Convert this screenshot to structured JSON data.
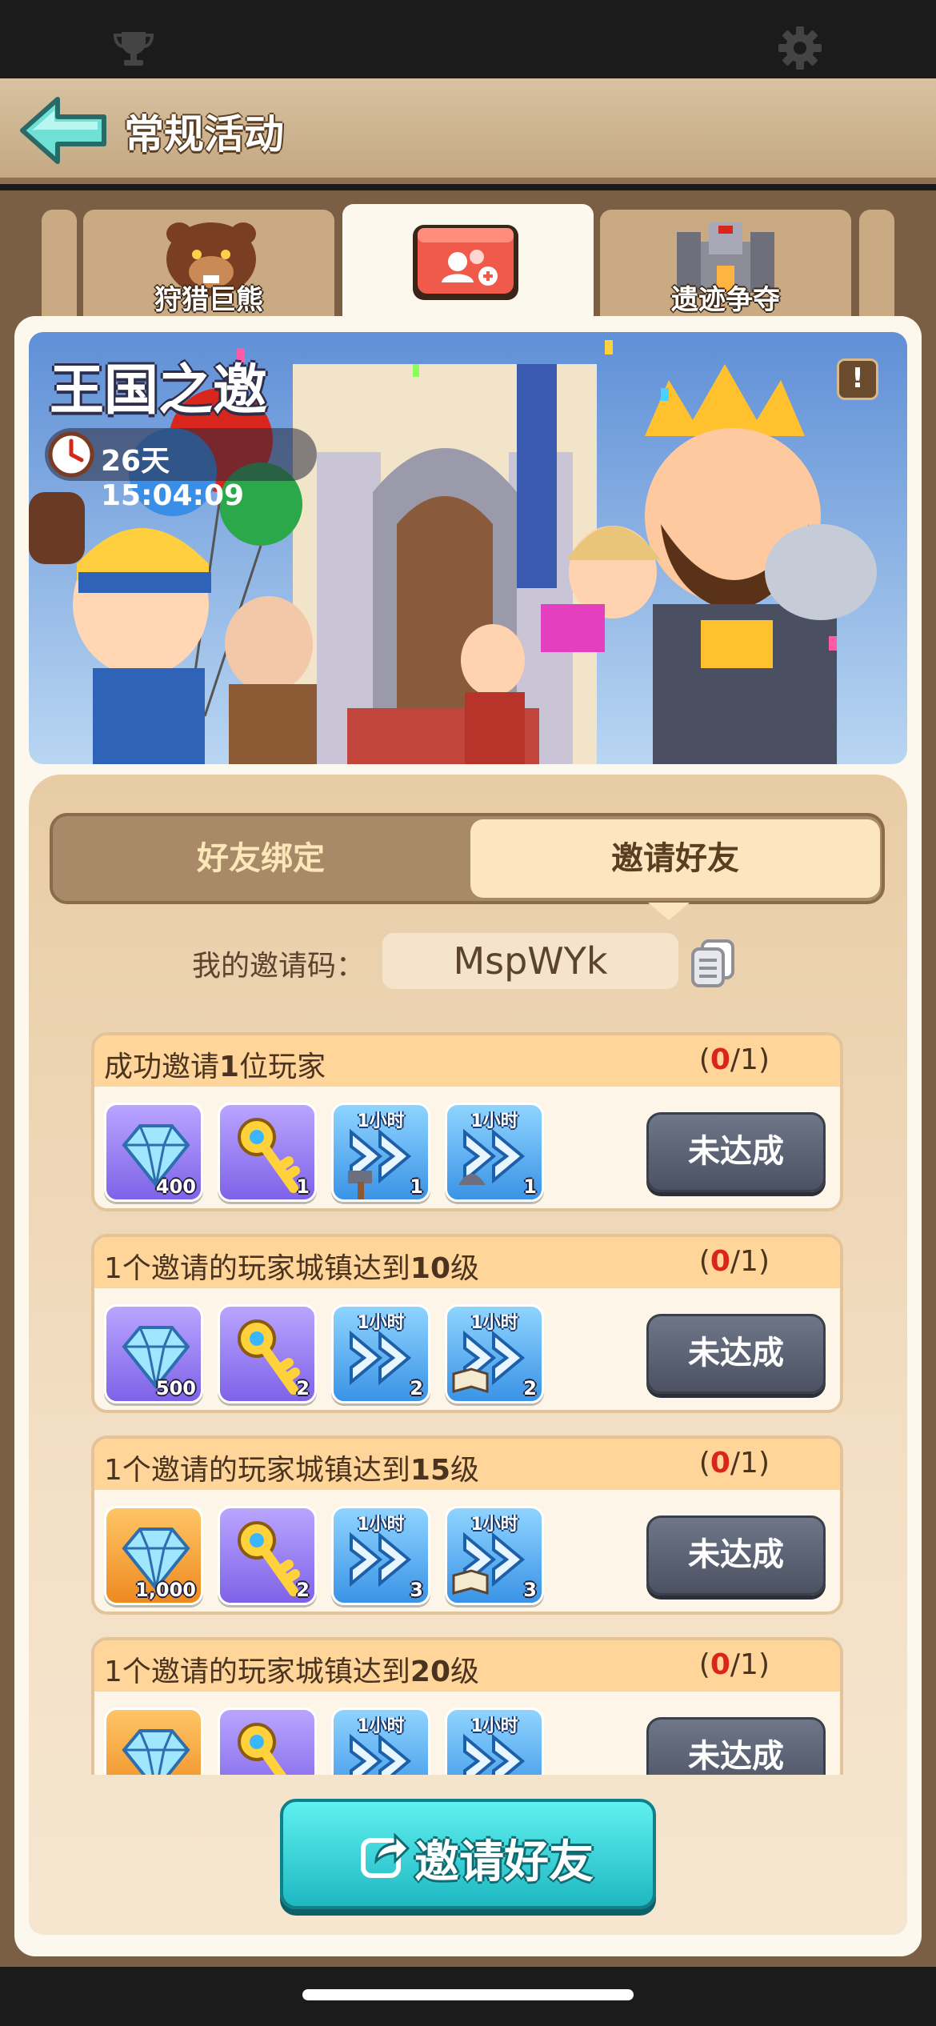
{
  "header": {
    "title": "常规活动"
  },
  "tabs": [
    {
      "label": "狩猎巨熊",
      "icon": "bear-icon"
    },
    {
      "label": "",
      "icon": "invite-envelope-icon",
      "active": true
    },
    {
      "label": "遗迹争夺",
      "icon": "ruins-castle-icon"
    }
  ],
  "event": {
    "title": "王国之邀",
    "countdown": "26天 15:04:09",
    "info_icon": "!"
  },
  "segment": {
    "left": "好友绑定",
    "right": "邀请好友",
    "active": "right"
  },
  "invite_code": {
    "label": "我的邀请码：",
    "value": "MspWYk"
  },
  "tasks": [
    {
      "title_pre": "成功邀请",
      "title_num": "1",
      "title_post": "位玩家",
      "progress_cur": "0",
      "progress_total": "1",
      "rewards": [
        {
          "type": "gems",
          "qty": "400",
          "color": "purple"
        },
        {
          "type": "key",
          "qty": "1",
          "color": "purple"
        },
        {
          "type": "speedup-hammer",
          "qty": "1",
          "tag": "1小时",
          "color": "blue"
        },
        {
          "type": "speedup-helmet",
          "qty": "1",
          "tag": "1小时",
          "color": "blue"
        }
      ],
      "status": "未达成"
    },
    {
      "title_pre": "1个邀请的玩家城镇达到",
      "title_num": "10",
      "title_post": "级",
      "progress_cur": "0",
      "progress_total": "1",
      "rewards": [
        {
          "type": "gems",
          "qty": "500",
          "color": "purple"
        },
        {
          "type": "key",
          "qty": "2",
          "color": "purple"
        },
        {
          "type": "speedup",
          "qty": "2",
          "tag": "1小时",
          "color": "blue"
        },
        {
          "type": "speedup-book",
          "qty": "2",
          "tag": "1小时",
          "color": "blue"
        }
      ],
      "status": "未达成"
    },
    {
      "title_pre": "1个邀请的玩家城镇达到",
      "title_num": "15",
      "title_post": "级",
      "progress_cur": "0",
      "progress_total": "1",
      "rewards": [
        {
          "type": "gems",
          "qty": "1,000",
          "color": "orange"
        },
        {
          "type": "key",
          "qty": "2",
          "color": "purple"
        },
        {
          "type": "speedup",
          "qty": "3",
          "tag": "1小时",
          "color": "blue"
        },
        {
          "type": "speedup-book",
          "qty": "3",
          "tag": "1小时",
          "color": "blue"
        }
      ],
      "status": "未达成"
    },
    {
      "title_pre": "1个邀请的玩家城镇达到",
      "title_num": "20",
      "title_post": "级",
      "progress_cur": "0",
      "progress_total": "1",
      "rewards": [
        {
          "type": "gems",
          "qty": "",
          "color": "orange"
        },
        {
          "type": "key",
          "qty": "",
          "color": "purple"
        },
        {
          "type": "speedup",
          "qty": "",
          "tag": "1小时",
          "color": "blue"
        },
        {
          "type": "speedup-book",
          "qty": "",
          "tag": "1小时",
          "color": "blue"
        }
      ],
      "status": "未达成"
    }
  ],
  "invite_button": {
    "label": "邀请好友"
  },
  "colors": {
    "accent_teal": "#1fb8c1",
    "progress_red": "#d9261c",
    "panel": "#f3dfc4"
  }
}
